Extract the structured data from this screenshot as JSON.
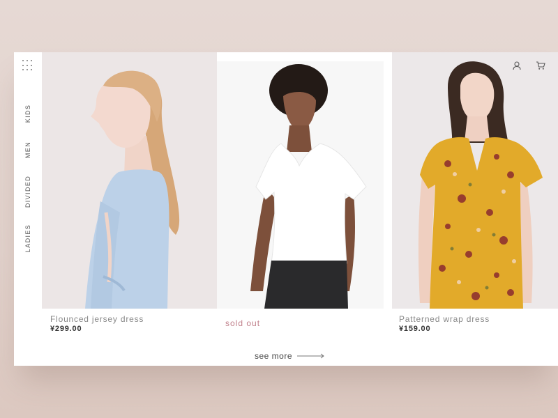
{
  "nav": {
    "menu_icon": "grid-dots-icon",
    "items": [
      {
        "label": "KIDS"
      },
      {
        "label": "MEN"
      },
      {
        "label": "DIVIDED"
      },
      {
        "label": "LADIES"
      }
    ]
  },
  "header_icons": {
    "account": "user-icon",
    "cart": "cart-icon"
  },
  "products": [
    {
      "name": "Flounced jersey dress",
      "price": "¥299.00"
    },
    {
      "status": "sold out"
    },
    {
      "name": "Patterned wrap dress",
      "price": "¥159.00"
    }
  ],
  "see_more": {
    "label": "see more",
    "icon": "arrow-right-icon"
  },
  "colors": {
    "background": "#e4d6d0",
    "sold_out": "#c07f8a",
    "dress_blue": "#b9cfe6",
    "dress_yellow": "#e2aa2a"
  }
}
